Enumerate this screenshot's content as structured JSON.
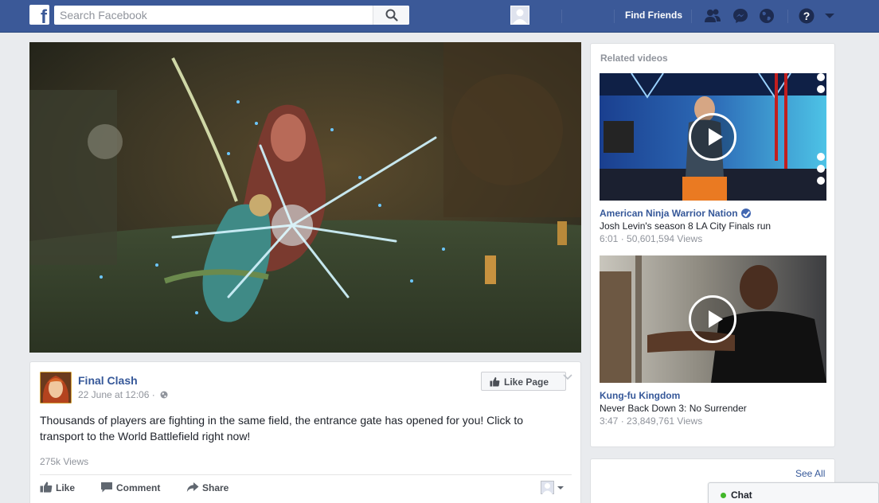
{
  "header": {
    "logo_letter": "f",
    "search_placeholder": "Search Facebook",
    "find_friends": "Find Friends",
    "icons": [
      "facebook-logo-icon",
      "search-icon",
      "friend-requests-icon",
      "messenger-icon",
      "notifications-globe-icon",
      "help-icon",
      "chevron-down-icon"
    ],
    "brand_color": "#3b5998"
  },
  "post": {
    "page_name": "Final Clash",
    "date": "22 June at 12:06 ·",
    "like_page_label": "Like Page",
    "text": "Thousands of players are fighting in the same field, the entrance gate has opened for you! Click to transport to the World Battlefield right now!",
    "views": "275k Views",
    "actions": {
      "like": "Like",
      "comment": "Comment",
      "share": "Share"
    }
  },
  "related": {
    "title": "Related videos",
    "videos": [
      {
        "channel": "American Ninja Warrior Nation",
        "verified": true,
        "title": "Josh Levin's season 8 LA City Finals run",
        "meta": "6:01 · 50,601,594 Views"
      },
      {
        "channel": "Kung-fu Kingdom",
        "verified": false,
        "title": "Never Back Down 3: No Surrender",
        "meta": "3:47 · 23,849,761 Views"
      }
    ]
  },
  "see_all": "See All",
  "chat": {
    "label": "Chat",
    "status_color": "#42b72a"
  }
}
